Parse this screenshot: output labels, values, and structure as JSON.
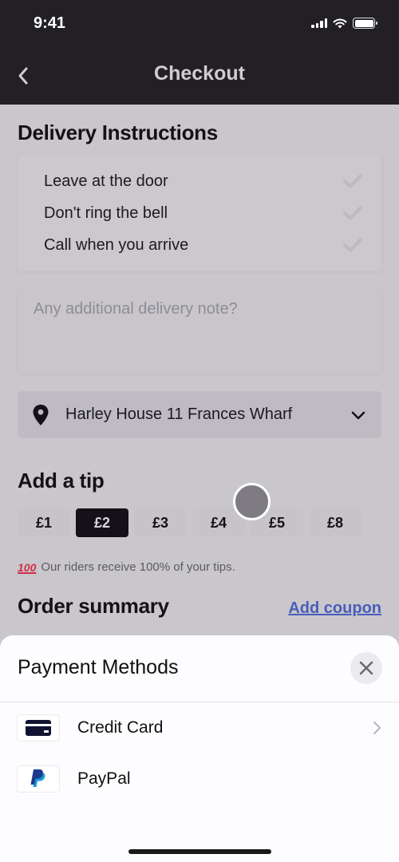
{
  "status_bar": {
    "time": "9:41",
    "icons": [
      "signal-icon",
      "wifi-icon",
      "battery-icon"
    ]
  },
  "header": {
    "title": "Checkout",
    "back_icon": "chevron-left-icon"
  },
  "delivery": {
    "title": "Delivery Instructions",
    "options": [
      {
        "label": "Leave at the door",
        "checked": false
      },
      {
        "label": "Don't ring the bell",
        "checked": false
      },
      {
        "label": "Call when you arrive",
        "checked": false
      }
    ],
    "note_placeholder": "Any additional delivery note?",
    "note_value": "",
    "address": "Harley House 11 Frances Wharf",
    "address_icon": "map-pin-icon"
  },
  "tip": {
    "title": "Add a tip",
    "options": [
      "£1",
      "£2",
      "£3",
      "£4",
      "£5",
      "£8"
    ],
    "selected": "£2",
    "note_emoji": "💯",
    "note": "Our riders receive 100% of your tips."
  },
  "order_summary": {
    "title": "Order summary",
    "coupon_link": "Add coupon"
  },
  "payment_sheet": {
    "title": "Payment Methods",
    "close_icon": "close-icon",
    "methods": [
      {
        "label": "Credit Card",
        "icon": "credit-card-icon",
        "has_chevron": true
      },
      {
        "label": "PayPal",
        "icon": "paypal-icon",
        "has_chevron": false
      }
    ]
  },
  "colors": {
    "header_bg": "#222025",
    "selected_tip_bg": "#141218",
    "link": "#4a5dba",
    "sheet_bg": "#fdfcfe",
    "paypal_dark": "#1b3a8c",
    "paypal_light": "#139ad6"
  }
}
